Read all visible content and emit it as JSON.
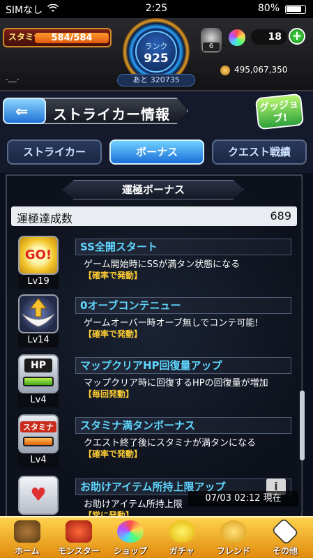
{
  "status_bar": {
    "carrier": "SIMなし",
    "time": "2:25",
    "battery": "80%"
  },
  "hud": {
    "stamina_label": "スタミナ",
    "stamina_value": "584/584",
    "rank_label": "ランク",
    "rank_value": "925",
    "rank_next": "あと 320735",
    "luck_count": "6",
    "orb_count": "18",
    "plus_label": "+",
    "coin_count": "495,067,350",
    "player_name": ".__."
  },
  "header": {
    "back_label": "⇐",
    "title": "ストライカー情報",
    "good_job_label": "グッジョブ!"
  },
  "tabs": [
    {
      "label": "ストライカー",
      "active": false
    },
    {
      "label": "ボーナス",
      "active": true
    },
    {
      "label": "クエスト戦績",
      "active": false
    }
  ],
  "section": {
    "header": "運極ボーナス",
    "count_label": "運極達成数",
    "count_value": "689"
  },
  "bonuses": [
    {
      "icon": "go-icon",
      "icon_text": "GO!",
      "level": "Lv19",
      "title": "SS全開スタート",
      "desc": "ゲーム開始時にSSが満タン状態になる",
      "trigger": "【確率で発動】"
    },
    {
      "icon": "wing-arrow-icon",
      "icon_text": "",
      "level": "Lv14",
      "title": "0オーブコンテニュー",
      "desc": "ゲームオーバー時オーブ無しでコンテ可能!",
      "trigger": "【確率で発動】"
    },
    {
      "icon": "hp-icon",
      "icon_text": "HP",
      "level": "Lv4",
      "title": "マップクリアHP回復量アップ",
      "desc": "マップクリア時に回復するHPの回復量が増加",
      "trigger": "【毎回発動】"
    },
    {
      "icon": "stamina-icon",
      "icon_text": "スタミナ",
      "level": "Lv4",
      "title": "スタミナ満タンボーナス",
      "desc": "クエスト終了後にスタミナが満タンになる",
      "trigger": "【確率で発動】"
    },
    {
      "icon": "item-heart-icon",
      "icon_text": "",
      "level": "",
      "title": "お助けアイテム所持上限アップ",
      "desc": "お助けアイテム所持上限",
      "trigger": "【常に発動】"
    }
  ],
  "overlay": {
    "time": "07/03 02:12 現在",
    "info_label": "i"
  },
  "nav": [
    {
      "label": "ホーム",
      "icon": "home-icon"
    },
    {
      "label": "モンスター",
      "icon": "monster-icon"
    },
    {
      "label": "ショップ",
      "icon": "shop-orb-icon"
    },
    {
      "label": "ガチャ",
      "icon": "gacha-icon"
    },
    {
      "label": "フレンド",
      "icon": "friend-icon"
    },
    {
      "label": "その他",
      "icon": "other-icon"
    }
  ],
  "colors": {
    "accent_blue": "#1b6ed8",
    "title_cyan": "#5fd7ff",
    "trigger_yellow": "#ffcf33",
    "nav_gold": "#ffd24d"
  }
}
